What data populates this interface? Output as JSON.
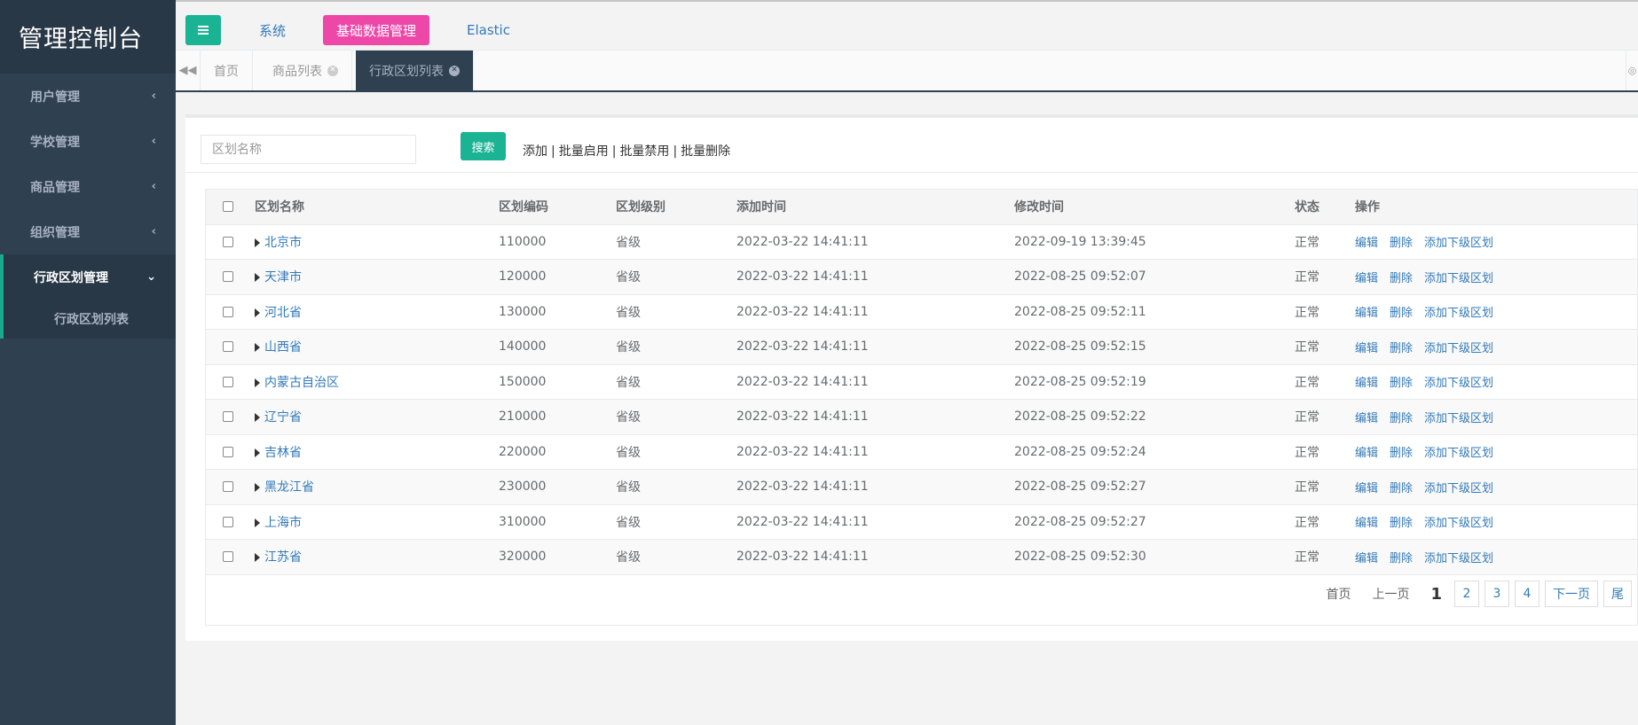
{
  "brand": "管理控制台",
  "sidebar": {
    "items": [
      {
        "label": "用户管理"
      },
      {
        "label": "学校管理"
      },
      {
        "label": "商品管理"
      },
      {
        "label": "组织管理"
      },
      {
        "label": "行政区划管理"
      }
    ],
    "submenu": {
      "label": "行政区划列表"
    }
  },
  "topnav": {
    "links": [
      "系统",
      "基础数据管理",
      "Elastic"
    ],
    "active_color": "#ed48a8"
  },
  "tabs": {
    "items": [
      "首页",
      "商品列表",
      "行政区划列表"
    ]
  },
  "search": {
    "placeholder": "区划名称",
    "button": "搜索"
  },
  "actions": [
    "添加",
    "批量启用",
    "批量禁用",
    "批量删除"
  ],
  "table": {
    "headers": [
      "区划名称",
      "区划编码",
      "区划级别",
      "添加时间",
      "修改时间",
      "状态",
      "操作"
    ],
    "rows": [
      {
        "name": "北京市",
        "code": "110000",
        "level": "省级",
        "created": "2022-03-22 14:41:11",
        "modified": "2022-09-19 13:39:45",
        "status": "正常"
      },
      {
        "name": "天津市",
        "code": "120000",
        "level": "省级",
        "created": "2022-03-22 14:41:11",
        "modified": "2022-08-25 09:52:07",
        "status": "正常"
      },
      {
        "name": "河北省",
        "code": "130000",
        "level": "省级",
        "created": "2022-03-22 14:41:11",
        "modified": "2022-08-25 09:52:11",
        "status": "正常"
      },
      {
        "name": "山西省",
        "code": "140000",
        "level": "省级",
        "created": "2022-03-22 14:41:11",
        "modified": "2022-08-25 09:52:15",
        "status": "正常"
      },
      {
        "name": "内蒙古自治区",
        "code": "150000",
        "level": "省级",
        "created": "2022-03-22 14:41:11",
        "modified": "2022-08-25 09:52:19",
        "status": "正常"
      },
      {
        "name": "辽宁省",
        "code": "210000",
        "level": "省级",
        "created": "2022-03-22 14:41:11",
        "modified": "2022-08-25 09:52:22",
        "status": "正常"
      },
      {
        "name": "吉林省",
        "code": "220000",
        "level": "省级",
        "created": "2022-03-22 14:41:11",
        "modified": "2022-08-25 09:52:24",
        "status": "正常"
      },
      {
        "name": "黑龙江省",
        "code": "230000",
        "level": "省级",
        "created": "2022-03-22 14:41:11",
        "modified": "2022-08-25 09:52:27",
        "status": "正常"
      },
      {
        "name": "上海市",
        "code": "310000",
        "level": "省级",
        "created": "2022-03-22 14:41:11",
        "modified": "2022-08-25 09:52:27",
        "status": "正常"
      },
      {
        "name": "江苏省",
        "code": "320000",
        "level": "省级",
        "created": "2022-03-22 14:41:11",
        "modified": "2022-08-25 09:52:30",
        "status": "正常"
      }
    ],
    "ops": [
      "编辑",
      "删除",
      "添加下级区划"
    ]
  },
  "pager": {
    "first": "首页",
    "prev": "上一页",
    "current": "1",
    "pages": [
      "2",
      "3",
      "4"
    ],
    "next": "下一页",
    "last": "尾"
  }
}
